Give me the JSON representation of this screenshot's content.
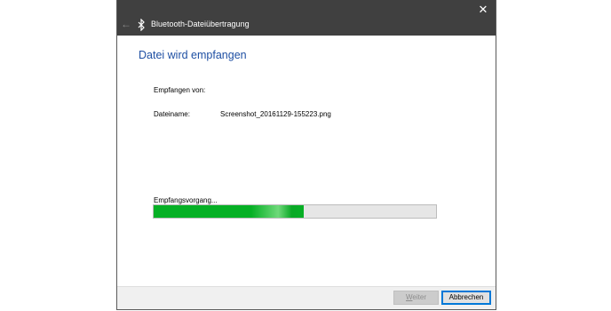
{
  "window": {
    "title": "Bluetooth-Dateiübertragung",
    "back_glyph": "←",
    "close_glyph": "✕"
  },
  "main": {
    "heading": "Datei wird empfangen",
    "received_from_label": "Empfangen von:",
    "received_from_value": "",
    "filename_label": "Dateiname:",
    "filename_value": "Screenshot_20161129-155223.png",
    "progress_label": "Empfangsvorgang...",
    "progress_fraction": 0.53
  },
  "footer": {
    "next_label": "Weiter",
    "next_accel_char": "W",
    "cancel_label": "Abbrechen"
  },
  "colors": {
    "titlebar": "#404040",
    "heading": "#1e4fa3",
    "progress": "#06b025",
    "focus_border": "#0078d7"
  },
  "icons": [
    "back-arrow-icon",
    "bluetooth-icon",
    "close-icon"
  ]
}
